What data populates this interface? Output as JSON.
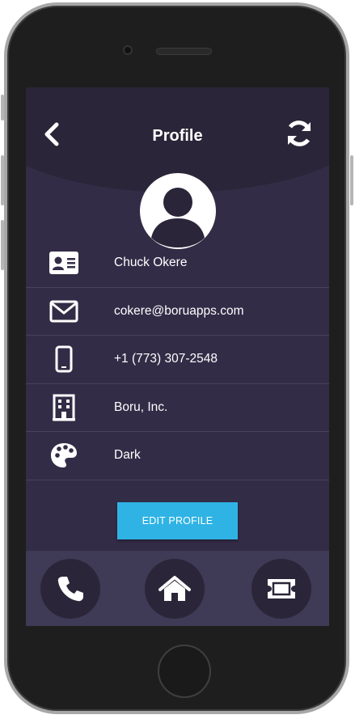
{
  "header": {
    "title": "Profile",
    "back_icon": "chevron-left-icon",
    "refresh_icon": "refresh-icon"
  },
  "profile": {
    "avatar_icon": "user-avatar-icon",
    "rows": [
      {
        "icon": "id-card-icon",
        "value": "Chuck Okere"
      },
      {
        "icon": "envelope-icon",
        "value": "cokere@boruapps.com"
      },
      {
        "icon": "mobile-phone-icon",
        "value": "+1 (773) 307-2548"
      },
      {
        "icon": "building-icon",
        "value": "Boru, Inc."
      },
      {
        "icon": "palette-icon",
        "value": "Dark"
      }
    ]
  },
  "actions": {
    "edit_label": "EDIT PROFILE"
  },
  "bottom_nav": [
    {
      "icon": "phone-icon"
    },
    {
      "icon": "home-icon"
    },
    {
      "icon": "ticket-icon"
    }
  ],
  "colors": {
    "screen_bg": "#332c47",
    "header_bg": "#2a2538",
    "accent": "#2fb3e4",
    "bottom_bar": "#3f3a55"
  }
}
